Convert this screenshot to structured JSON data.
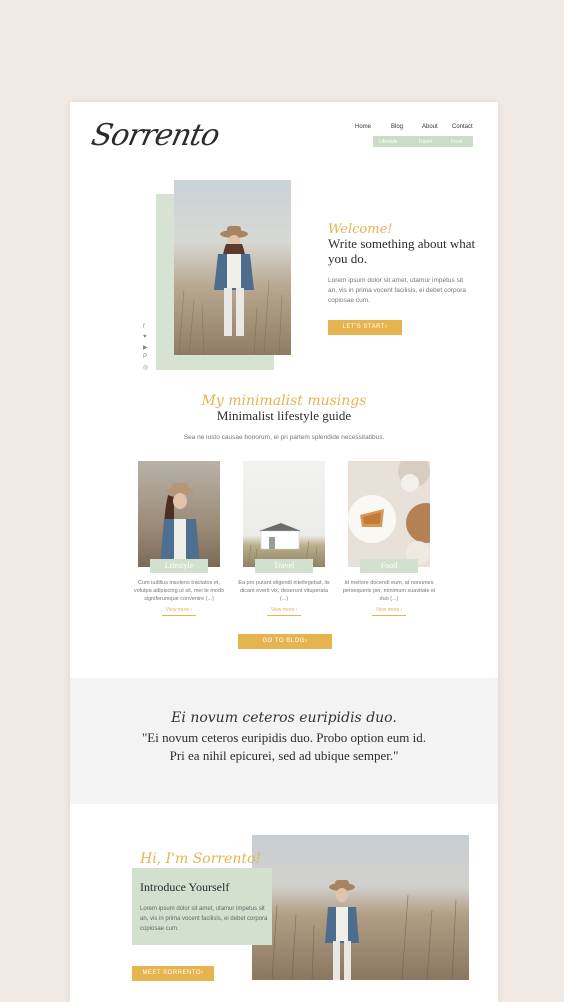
{
  "header": {
    "logo": "Sorrento",
    "nav": [
      "Home",
      "Blog",
      "About",
      "Contact"
    ],
    "sub_nav": [
      "Lifestyle",
      "Travel",
      "Food"
    ]
  },
  "hero": {
    "script": "Welcome!",
    "title": "Write something about what you do.",
    "text": "Lorem ipsum dolor sit amet, utamur impetus sit an, vis in prima vocent facilisis, ei debet corpora copiosae cum.",
    "button": "LET'S START›",
    "social_icons": [
      "facebook-icon",
      "twitter-icon",
      "youtube-icon",
      "pinterest-icon",
      "instagram-icon"
    ]
  },
  "guide": {
    "script": "My minimalist musings",
    "title": "Minimalist lifestyle guide",
    "subtitle": "Sea ne iusto causae bonorum, ei pri partem splendide necessitatibus."
  },
  "cards": [
    {
      "label": "Lifestyle",
      "text": "Cum iudilius insolens tractatos et, volutpa adipiscing ut sit, mei te modo signiferumque convenire (...)",
      "more": "View more ›"
    },
    {
      "label": "Travel",
      "text": "Ea pro putant eligendi intellegebat, iis dicant everti vix, deserunt vituperata (...)",
      "more": "View more ›"
    },
    {
      "label": "Food",
      "text": "Id meliore docendi eum, at nonumes persequeris per, minimum suavitate ei duo (...)",
      "more": "View more ›"
    }
  ],
  "blog_button": "GO TO BLOG›",
  "quote": {
    "script": "Ei novum ceteros euripidis duo.",
    "line1": "\"Ei novum ceteros euripidis duo. Probo option eum id.",
    "line2": "Pri ea nihil epicurei, sed ad ubique semper.\""
  },
  "intro": {
    "script": "Hi, I'm Sorrento!",
    "title": "Introduce Yourself",
    "text": "Lorem ipsum dolor sit amet, utamur impetus sit an, vis in prima vocent facilisis, ei debet corpora copiosae cum.",
    "button": "MEET SORRENTO›"
  },
  "colors": {
    "accent_gold": "#e5b44f",
    "accent_sage": "#cbdcc8",
    "background": "#f1e9e4"
  }
}
